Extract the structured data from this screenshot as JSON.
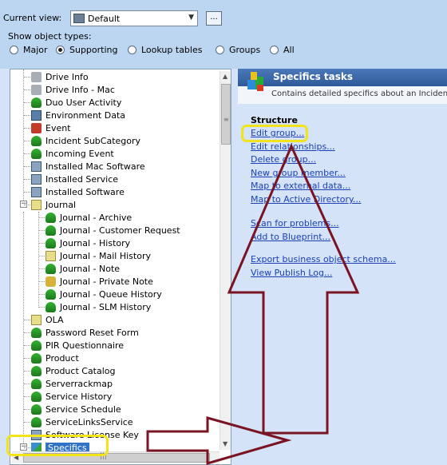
{
  "toolbar": {
    "current_view_label": "Current view:",
    "current_view_value": "Default",
    "browse_button": "...",
    "show_types_label": "Show object types:",
    "radio_options": [
      "Major",
      "Supporting",
      "Lookup tables",
      "Groups",
      "All"
    ],
    "selected_radio": "Supporting"
  },
  "tree": {
    "items": [
      {
        "label": "Drive Info",
        "icon": "disk-icon"
      },
      {
        "label": "Drive Info - Mac",
        "icon": "disk-icon"
      },
      {
        "label": "Duo User Activity",
        "icon": "person-icon"
      },
      {
        "label": "Environment Data",
        "icon": "computer-icon"
      },
      {
        "label": "Event",
        "icon": "book-icon"
      },
      {
        "label": "Incident SubCategory",
        "icon": "person-icon"
      },
      {
        "label": "Incoming Event",
        "icon": "person-icon"
      },
      {
        "label": "Installed Mac Software",
        "icon": "software-icon"
      },
      {
        "label": "Installed Service",
        "icon": "software-icon"
      },
      {
        "label": "Installed Software",
        "icon": "software-icon"
      },
      {
        "label": "Journal",
        "icon": "note-icon"
      },
      {
        "label": "Journal - Archive",
        "icon": "person-icon"
      },
      {
        "label": "Journal - Customer Request",
        "icon": "person-icon"
      },
      {
        "label": "Journal - History",
        "icon": "person-icon"
      },
      {
        "label": "Journal - Mail History",
        "icon": "note-icon"
      },
      {
        "label": "Journal - Note",
        "icon": "person-icon"
      },
      {
        "label": "Journal - Private Note",
        "icon": "lock-icon"
      },
      {
        "label": "Journal - Queue History",
        "icon": "person-icon"
      },
      {
        "label": "Journal - SLM History",
        "icon": "person-icon"
      },
      {
        "label": "OLA",
        "icon": "note-icon"
      },
      {
        "label": "Password Reset Form",
        "icon": "person-icon"
      },
      {
        "label": "PIR Questionnaire",
        "icon": "person-icon"
      },
      {
        "label": "Product",
        "icon": "person-icon"
      },
      {
        "label": "Product Catalog",
        "icon": "person-icon"
      },
      {
        "label": "Serverrackmap",
        "icon": "person-icon"
      },
      {
        "label": "Service History",
        "icon": "person-icon"
      },
      {
        "label": "Service Schedule",
        "icon": "person-icon"
      },
      {
        "label": "ServiceLinksService",
        "icon": "person-icon"
      },
      {
        "label": "Software License Key",
        "icon": "software-icon"
      },
      {
        "label": "Specifics",
        "icon": "specifics-icon",
        "selected": true
      }
    ]
  },
  "tasks": {
    "title": "Specifics tasks",
    "subtitle": "Contains detailed specifics about an Incident",
    "section": "Structure",
    "links_group1": [
      "Edit group...",
      "Edit relationships...",
      "Delete group...",
      "New group member...",
      "Map to external data...",
      "Map to Active Directory..."
    ],
    "links_group2": [
      "Scan for problems...",
      "Add to Blueprint..."
    ],
    "links_group3": [
      "Export business object schema...",
      "View Publish Log..."
    ]
  },
  "colors": {
    "highlight": "#f2e31a",
    "annotation_arrow": "#7a1422",
    "link": "#1a3fb8",
    "header": "#2f5a9a"
  }
}
